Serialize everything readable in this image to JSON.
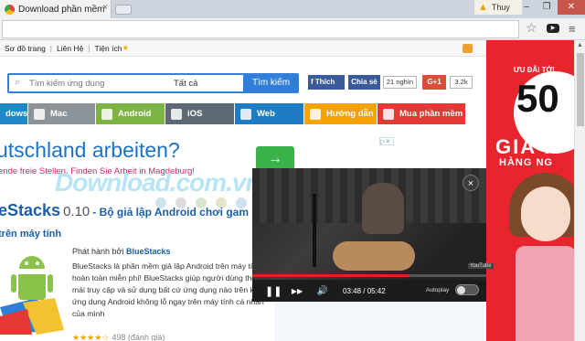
{
  "browser": {
    "tab_title": "Download phần mềm miễ",
    "tab_close": "×",
    "user_name": "Thuy",
    "win_minimize": "–",
    "win_maximize": "❐",
    "win_close": "✕"
  },
  "topnav": {
    "items": [
      "Sơ đồ trang",
      "Liên Hệ",
      "Tiện ích"
    ],
    "sep": "|"
  },
  "search": {
    "placeholder": "Tìm kiếm ứng dụng",
    "category": "Tất cả",
    "button": "Tìm kiếm"
  },
  "social": {
    "like_label": "Thích",
    "share_label": "Chia sẻ",
    "like_count": "21 nghìn",
    "gplus_label": "G+1",
    "gplus_count": "3.2k"
  },
  "categories": [
    {
      "label": "dows",
      "color": "#1e88c9"
    },
    {
      "label": "Mac",
      "color": "#8c9399"
    },
    {
      "label": "Android",
      "color": "#7cb342"
    },
    {
      "label": "iOS",
      "color": "#5d6a76"
    },
    {
      "label": "Web",
      "color": "#1e7cc4"
    },
    {
      "label": "Hướng dẫn",
      "color": "#f5a300"
    },
    {
      "label": "Mua phần mềm",
      "color": "#e53935"
    }
  ],
  "ad": {
    "title": "utschland arbeiten?",
    "subtitle": "ende freie Stellen. Finden Sie Arbeit in Magdeburg!",
    "button_arrow": "→"
  },
  "watermark": "Download.com.vn",
  "article": {
    "title_app": "eStacks",
    "title_version": "0.10",
    "title_rest": "- Bộ giả lập Android chơi gam",
    "subtitle": "trên máy tính",
    "publisher_prefix": "Phát hành bởi",
    "publisher": "BlueStacks",
    "description": "BlueStacks là phần mềm giả lập Android trên máy tính hoàn toàn miễn phí! BlueStacks giúp người dùng thoải mái truy cập và sử dụng bất cứ ứng dụng nào trên kho ứng dụng Android không lỗ ngay trên máy tính cá nhân của mình",
    "stars": "★★★★☆",
    "rating_text": "498 (đánh giá)"
  },
  "banner": {
    "line1": "ƯU ĐÃI TỚI",
    "big": "50",
    "line2": "GIÁ R",
    "line3": "HÀNG NG"
  },
  "video": {
    "close": "×",
    "play_pause": "❚❚",
    "next": "▶▶",
    "volume": "🔊",
    "time": "03:48 / 05:42",
    "progress_fraction": 0.667,
    "autoplay_label": "Autoplay",
    "autoplay_on": false,
    "yt_badge": "YouTube"
  }
}
